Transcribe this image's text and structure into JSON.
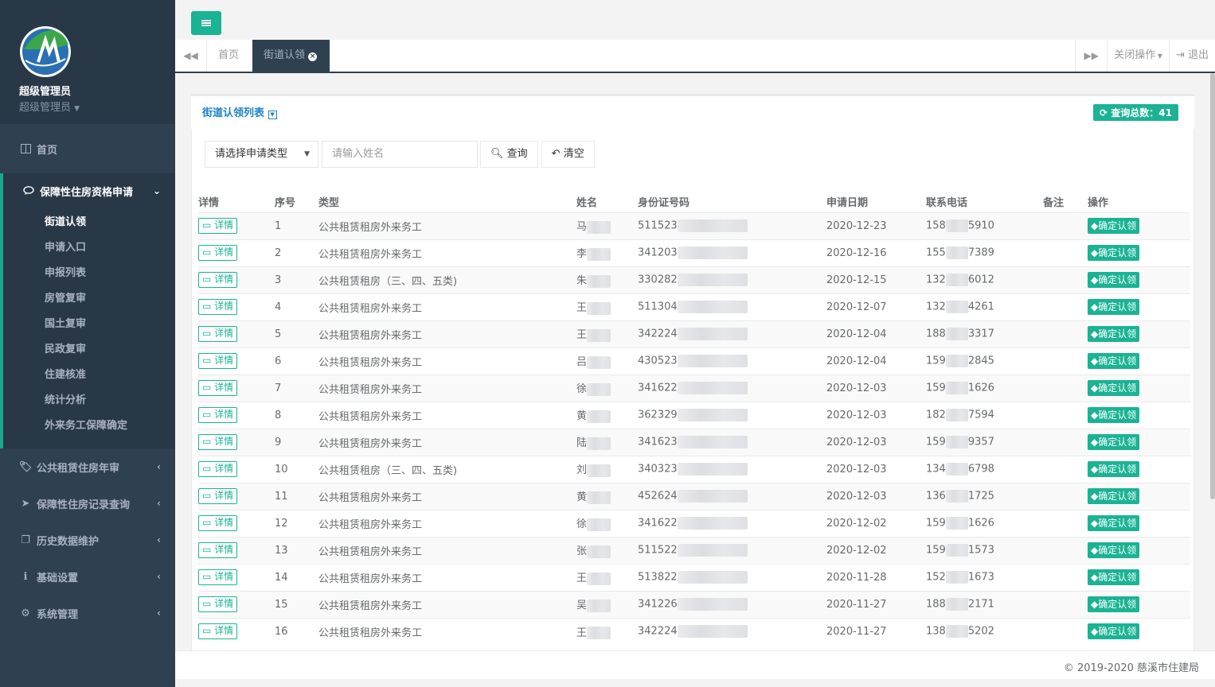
{
  "profile": {
    "name": "超级管理员",
    "role": "超级管理员"
  },
  "nav": {
    "home": "首页",
    "active_group": "保障性住房资格申请",
    "sub_items": [
      "街道认领",
      "申请入口",
      "申报列表",
      "房管复审",
      "国土复审",
      "民政复审",
      "住建核准",
      "统计分析",
      "外来务工保障确定"
    ],
    "groups": [
      {
        "label": "公共租赁住房年审",
        "icon": "tag-icon"
      },
      {
        "label": "保障性住房记录查询",
        "icon": "send-icon"
      },
      {
        "label": "历史数据维护",
        "icon": "copy-icon"
      },
      {
        "label": "基础设置",
        "icon": "info-icon"
      },
      {
        "label": "系统管理",
        "icon": "cog-icon"
      }
    ]
  },
  "tabs": {
    "home": "首页",
    "current": "街道认领",
    "close_ops": "关闭操作",
    "logout": "退出"
  },
  "box": {
    "title": "街道认领列表",
    "count_label": "查询总数：41"
  },
  "filters": {
    "type_placeholder": "请选择申请类型",
    "name_placeholder": "请输入姓名",
    "search": "查询",
    "clear": "清空"
  },
  "table": {
    "headers": [
      "详情",
      "序号",
      "类型",
      "姓名",
      "身份证号码",
      "申请日期",
      "联系电话",
      "备注",
      "操作"
    ],
    "detail_label": "详情",
    "action_label": "确定认领",
    "rows": [
      {
        "no": "1",
        "type": "公共租赁租房外来务工",
        "name": "马",
        "id": "511523",
        "date": "2020-12-23",
        "phone_a": "158",
        "phone_b": "5910"
      },
      {
        "no": "2",
        "type": "公共租赁租房外来务工",
        "name": "李",
        "id": "341203",
        "date": "2020-12-16",
        "phone_a": "155",
        "phone_b": "7389"
      },
      {
        "no": "3",
        "type": "公共租赁租房（三、四、五类)",
        "name": "朱",
        "id": "330282",
        "date": "2020-12-15",
        "phone_a": "132",
        "phone_b": "6012"
      },
      {
        "no": "4",
        "type": "公共租赁租房外来务工",
        "name": "王",
        "id": "511304",
        "date": "2020-12-07",
        "phone_a": "132",
        "phone_b": "4261"
      },
      {
        "no": "5",
        "type": "公共租赁租房外来务工",
        "name": "王",
        "id": "342224",
        "date": "2020-12-04",
        "phone_a": "188",
        "phone_b": "3317"
      },
      {
        "no": "6",
        "type": "公共租赁租房外来务工",
        "name": "吕",
        "id": "430523",
        "date": "2020-12-04",
        "phone_a": "159",
        "phone_b": "2845"
      },
      {
        "no": "7",
        "type": "公共租赁租房外来务工",
        "name": "徐",
        "id": "341622",
        "date": "2020-12-03",
        "phone_a": "159",
        "phone_b": "1626"
      },
      {
        "no": "8",
        "type": "公共租赁租房外来务工",
        "name": "黄",
        "id": "362329",
        "date": "2020-12-03",
        "phone_a": "182",
        "phone_b": "7594"
      },
      {
        "no": "9",
        "type": "公共租赁租房外来务工",
        "name": "陆",
        "id": "341623",
        "date": "2020-12-03",
        "phone_a": "159",
        "phone_b": "9357"
      },
      {
        "no": "10",
        "type": "公共租赁租房（三、四、五类)",
        "name": "刘",
        "id": "340323",
        "date": "2020-12-03",
        "phone_a": "134",
        "phone_b": "6798"
      },
      {
        "no": "11",
        "type": "公共租赁租房外来务工",
        "name": "黄",
        "id": "452624",
        "date": "2020-12-03",
        "phone_a": "136",
        "phone_b": "1725"
      },
      {
        "no": "12",
        "type": "公共租赁租房外来务工",
        "name": "徐",
        "id": "341622",
        "date": "2020-12-02",
        "phone_a": "159",
        "phone_b": "1626"
      },
      {
        "no": "13",
        "type": "公共租赁租房外来务工",
        "name": "张",
        "id": "511522",
        "date": "2020-12-02",
        "phone_a": "159",
        "phone_b": "1573"
      },
      {
        "no": "14",
        "type": "公共租赁租房外来务工",
        "name": "王",
        "id": "513822",
        "date": "2020-11-28",
        "phone_a": "152",
        "phone_b": "1673"
      },
      {
        "no": "15",
        "type": "公共租赁租房外来务工",
        "name": "吴",
        "id": "341226",
        "date": "2020-11-27",
        "phone_a": "188",
        "phone_b": "2171"
      },
      {
        "no": "16",
        "type": "公共租赁租房外来务工",
        "name": "王",
        "id": "342224",
        "date": "2020-11-27",
        "phone_a": "138",
        "phone_b": "5202"
      }
    ]
  },
  "footer": "© 2019-2020 慈溪市住建局",
  "colors": {
    "sidebar": "#2f4050",
    "accent": "#1ab394",
    "title": "#1c84c6"
  }
}
